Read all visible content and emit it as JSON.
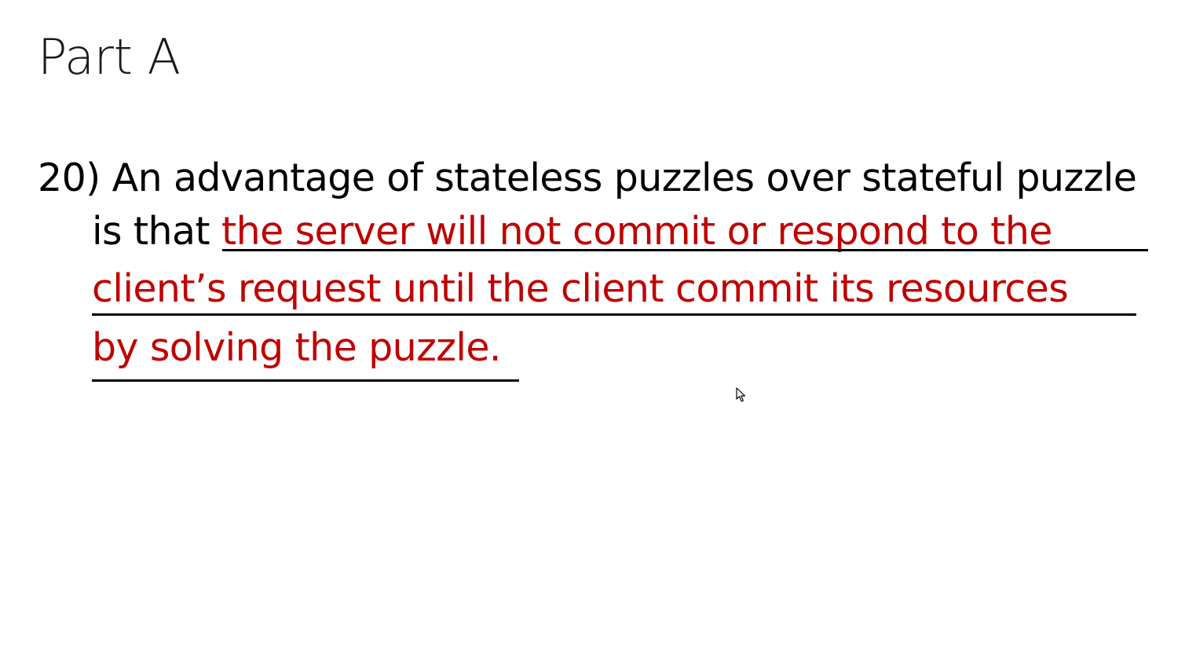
{
  "slide": {
    "title": "Part A",
    "question": {
      "prefix_line1": "20) An advantage of stateless puzzles over stateful puzzle",
      "prefix_line2": "is that",
      "answer_line1": "the server will not commit or respond to the",
      "answer_line2": "client’s request until the client commit its resources",
      "answer_line3": "by solving the puzzle."
    },
    "colors": {
      "question_text": "#000000",
      "answer_text": "#c00000",
      "background": "#ffffff"
    },
    "icons": {
      "cursor": "mouse-pointer-icon"
    }
  }
}
